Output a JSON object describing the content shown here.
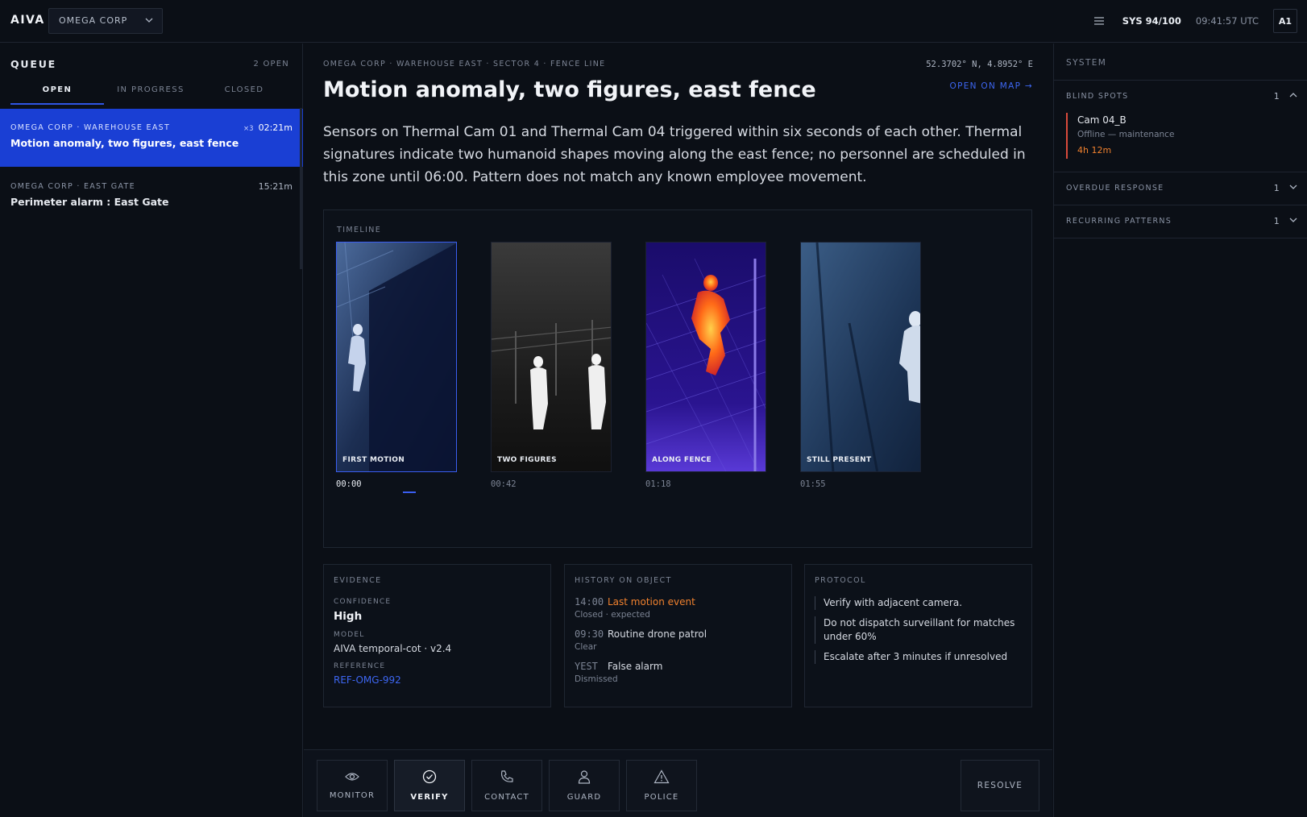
{
  "topbar": {
    "logo": "AIVA",
    "org": "OMEGA CORP",
    "sys_score": "SYS 94/100",
    "clock": "09:41:57 UTC",
    "avatar": "A1"
  },
  "queue": {
    "title": "QUEUE",
    "open_count": "2 OPEN",
    "tabs": [
      "OPEN",
      "IN PROGRESS",
      "CLOSED"
    ],
    "items": [
      {
        "site": "OMEGA CORP · WAREHOUSE EAST",
        "title": "Motion anomaly, two figures, east fence",
        "multiplier": "×3",
        "elapsed": "02:21m"
      },
      {
        "site": "OMEGA CORP · EAST GATE",
        "title": "Perimeter alarm : East Gate",
        "multiplier": "",
        "elapsed": "15:21m"
      }
    ]
  },
  "incident": {
    "breadcrumb": "OMEGA CORP · WAREHOUSE EAST · SECTOR 4 · FENCE LINE",
    "coords": "52.3702° N, 4.8952° E",
    "map_link": "OPEN ON MAP →",
    "title": "Motion anomaly, two figures, east fence",
    "description": "Sensors on Thermal Cam 01 and Thermal Cam 04 triggered within six seconds of each other. Thermal signatures indicate two humanoid shapes moving along the east fence; no personnel are scheduled in this zone until 06:00. Pattern does not match any known employee movement."
  },
  "timeline": {
    "label": "TIMELINE",
    "frames": [
      {
        "caption": "FIRST MOTION",
        "time": "00:00"
      },
      {
        "caption": "TWO FIGURES",
        "time": "00:42"
      },
      {
        "caption": "ALONG FENCE",
        "time": "01:18"
      },
      {
        "caption": "STILL PRESENT",
        "time": "01:55"
      }
    ]
  },
  "evidence": {
    "title": "EVIDENCE",
    "confidence_label": "CONFIDENCE",
    "confidence": "High",
    "model_label": "MODEL",
    "model": "AIVA temporal-cot · v2.4",
    "reference_label": "REFERENCE",
    "reference": "REF-OMG-992"
  },
  "history": {
    "title": "HISTORY ON OBJECT",
    "rows": [
      {
        "time": "14:00",
        "event": "Last motion event",
        "sub": "Closed · expected"
      },
      {
        "time": "09:30",
        "event": "Routine drone patrol",
        "sub": "Clear"
      },
      {
        "time": "YEST",
        "event": "False alarm",
        "sub": "Dismissed"
      }
    ]
  },
  "protocol": {
    "title": "PROTOCOL",
    "items": [
      "Verify with adjacent camera.",
      "Do not dispatch surveillant for matches under 60%",
      "Escalate after 3 minutes if unresolved"
    ]
  },
  "actions": {
    "buttons": [
      {
        "label": "MONITOR",
        "icon": "eye-icon"
      },
      {
        "label": "VERIFY",
        "icon": "check-circle-icon"
      },
      {
        "label": "CONTACT",
        "icon": "phone-icon"
      },
      {
        "label": "GUARD",
        "icon": "person-icon"
      },
      {
        "label": "POLICE",
        "icon": "warning-icon"
      }
    ],
    "resolve": "RESOLVE"
  },
  "system": {
    "title": "SYSTEM",
    "sections": [
      {
        "title": "BLIND SPOTS",
        "count": "1"
      },
      {
        "title": "OVERDUE RESPONSE",
        "count": "1"
      },
      {
        "title": "RECURRING PATTERNS",
        "count": "1"
      }
    ],
    "blind_spot": {
      "name": "Cam 04_B",
      "status": "Offline — maintenance",
      "duration": "4h 12m"
    }
  },
  "colors": {
    "accent": "#1a3fd4",
    "link": "#3d66f2",
    "warning": "#f0812e",
    "alert": "#d94a3b",
    "background": "#0b0f16"
  }
}
